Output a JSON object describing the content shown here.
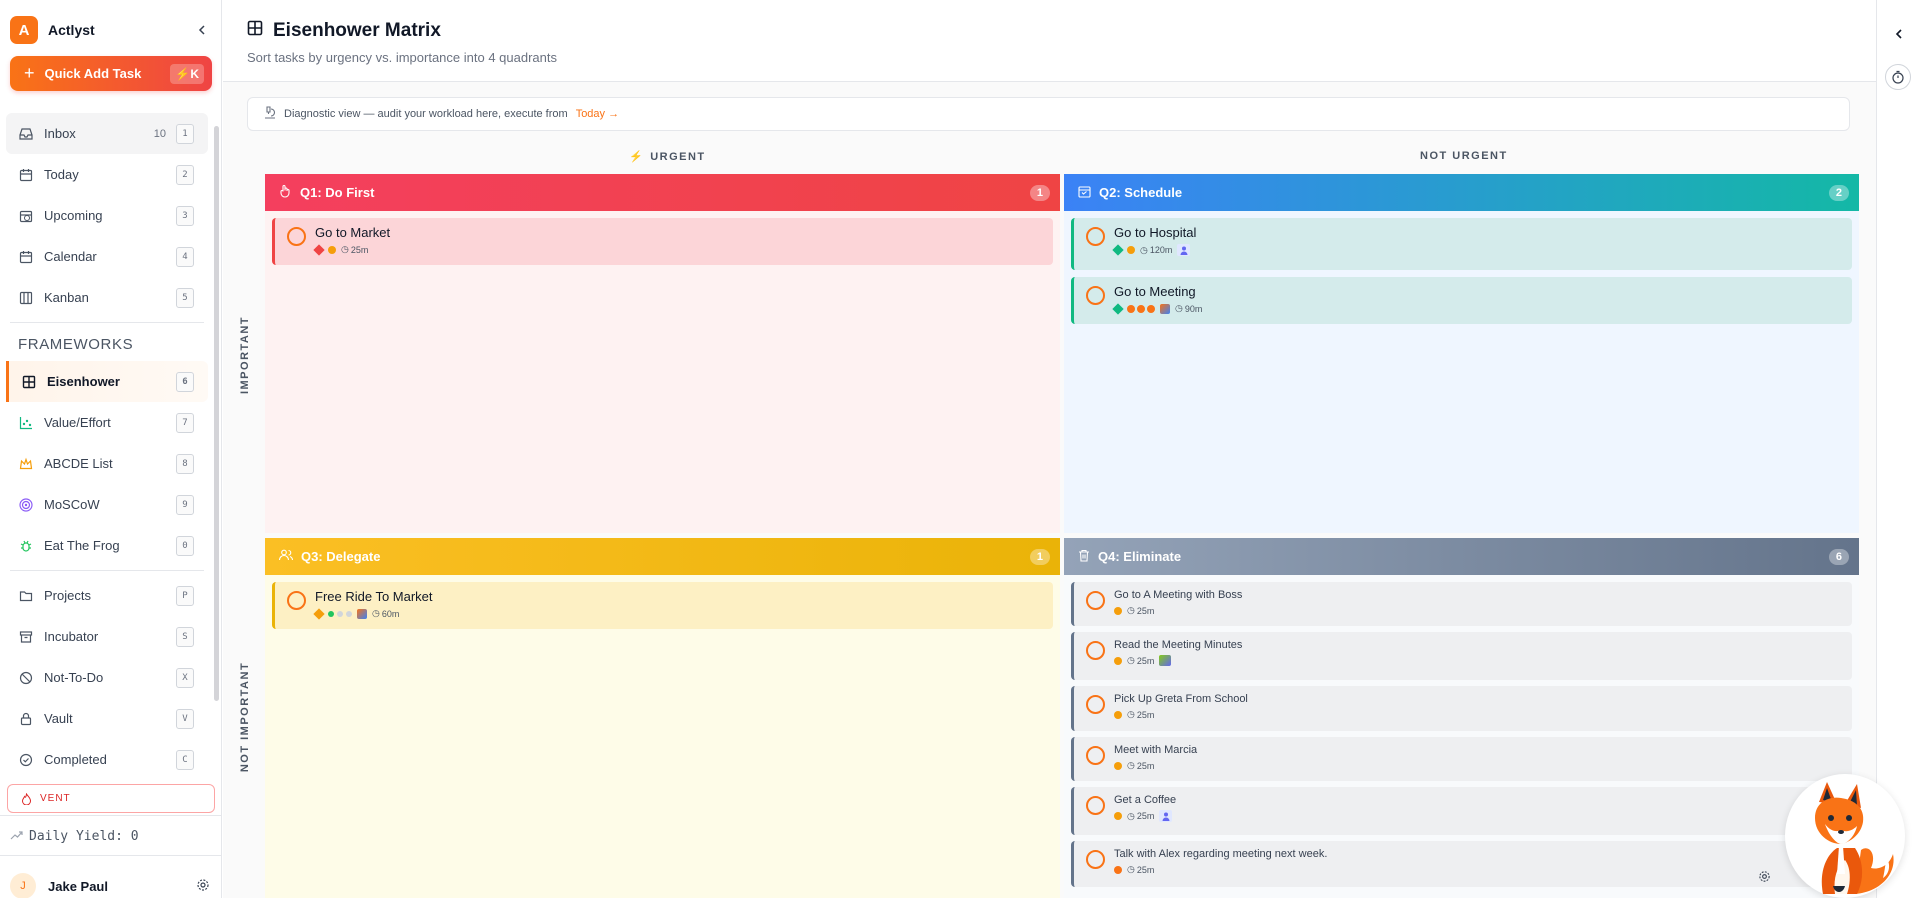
{
  "app": {
    "name": "Actlyst",
    "logo_letter": "A"
  },
  "quick_add": {
    "label": "Quick Add Task",
    "shortcut": "⚡K"
  },
  "nav": {
    "main": [
      {
        "label": "Inbox",
        "count": "10",
        "key": "1",
        "icon": "inbox-icon"
      },
      {
        "label": "Today",
        "count": "",
        "key": "2",
        "icon": "calendar-icon"
      },
      {
        "label": "Upcoming",
        "count": "",
        "key": "3",
        "icon": "calendar-clock-icon"
      },
      {
        "label": "Calendar",
        "count": "",
        "key": "4",
        "icon": "calendar-icon"
      },
      {
        "label": "Kanban",
        "count": "",
        "key": "5",
        "icon": "columns-icon"
      }
    ],
    "frameworks_heading": "FRAMEWORKS",
    "frameworks": [
      {
        "label": "Eisenhower",
        "key": "6",
        "icon": "grid-icon"
      },
      {
        "label": "Value/Effort",
        "key": "7",
        "icon": "scatter-icon"
      },
      {
        "label": "ABCDE List",
        "key": "8",
        "icon": "crown-icon"
      },
      {
        "label": "MoSCoW",
        "key": "9",
        "icon": "target-icon"
      },
      {
        "label": "Eat The Frog",
        "key": "0",
        "icon": "bug-icon"
      }
    ],
    "other": [
      {
        "label": "Projects",
        "key": "P",
        "icon": "folder-icon"
      },
      {
        "label": "Incubator",
        "key": "S",
        "icon": "archive-icon"
      },
      {
        "label": "Not-To-Do",
        "key": "X",
        "icon": "ban-icon"
      },
      {
        "label": "Vault",
        "key": "V",
        "icon": "lock-icon"
      },
      {
        "label": "Completed",
        "key": "C",
        "icon": "check-circle-icon"
      }
    ]
  },
  "vent": {
    "label": "VENT"
  },
  "daily_yield": "Daily Yield: 0",
  "user": {
    "name": "Jake Paul",
    "initial": "J"
  },
  "page": {
    "title": "Eisenhower Matrix",
    "subtitle": "Sort tasks by urgency vs. importance into 4 quadrants",
    "banner_text": "Diagnostic view — audit your workload here, execute from",
    "banner_link": "Today →"
  },
  "axes": {
    "urgent": "URGENT",
    "not_urgent": "NOT URGENT",
    "important": "IMPORTANT",
    "not_important": "NOT IMPORTANT"
  },
  "quadrants": {
    "q1": {
      "title": "Q1: Do First",
      "count": "1",
      "color": "#ef4444",
      "tasks": [
        {
          "title": "Go to Market",
          "duration": "25m"
        }
      ]
    },
    "q2": {
      "title": "Q2: Schedule",
      "count": "2",
      "color": "#3b82f6",
      "tasks": [
        {
          "title": "Go to Hospital",
          "duration": "120m"
        },
        {
          "title": "Go to Meeting",
          "duration": "90m"
        }
      ]
    },
    "q3": {
      "title": "Q3: Delegate",
      "count": "1",
      "color": "#eab308",
      "tasks": [
        {
          "title": "Free Ride To Market",
          "duration": "60m"
        }
      ]
    },
    "q4": {
      "title": "Q4: Eliminate",
      "count": "6",
      "color": "#64748b",
      "tasks": [
        {
          "title": "Go to A Meeting with Boss",
          "duration": "25m"
        },
        {
          "title": "Read the Meeting Minutes",
          "duration": "25m"
        },
        {
          "title": "Pick Up Greta From School",
          "duration": "25m"
        },
        {
          "title": "Meet with Marcia",
          "duration": "25m"
        },
        {
          "title": "Get a Coffee",
          "duration": "25m"
        },
        {
          "title": "Talk with Alex regarding meeting next week.",
          "duration": "25m"
        }
      ]
    }
  }
}
